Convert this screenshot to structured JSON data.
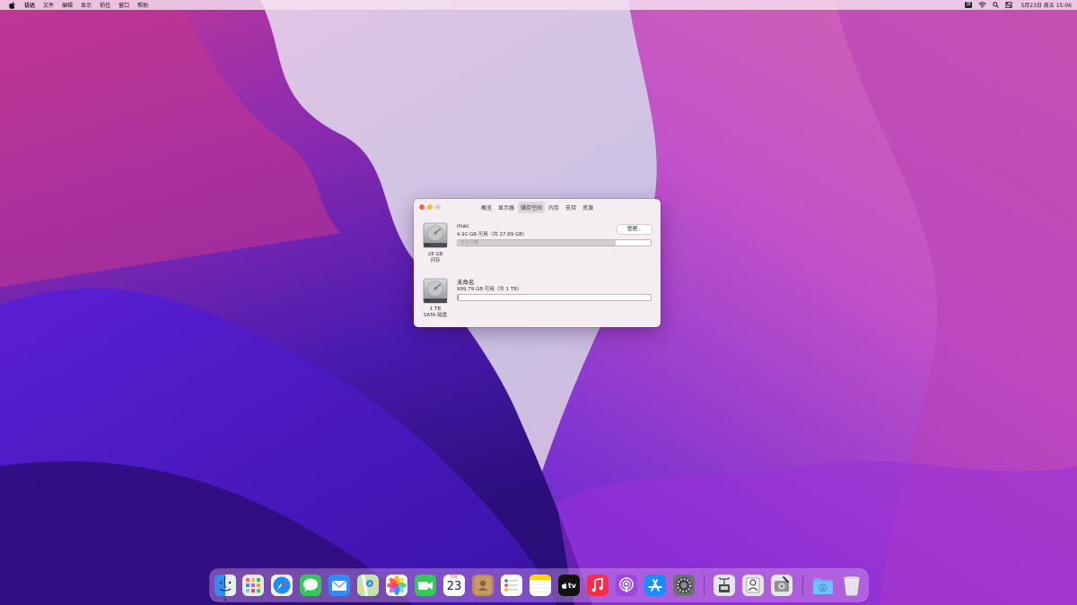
{
  "menubar": {
    "app_menus": [
      "访达",
      "文件",
      "编辑",
      "显示",
      "前往",
      "窗口",
      "帮助"
    ],
    "status_icons": [
      "input-method-icon",
      "wifi-icon",
      "spotlight-icon",
      "control-center-icon"
    ],
    "input_badge": "拼",
    "clock": "5月23日 周五 15:06"
  },
  "window": {
    "tabs": [
      "概览",
      "显示器",
      "储存空间",
      "内存",
      "支持",
      "资源"
    ],
    "active_tab": "储存空间",
    "drives": [
      {
        "name": "mac",
        "available": "4.92 GB 可用（共 27.69 GB）",
        "size_label": "28 GB",
        "type_label": "闪存",
        "used_fraction": 0.82,
        "bar_text": "正在计算...",
        "manage_label": "管理..."
      },
      {
        "name": "未命名",
        "available": "999.79 GB 可用（共 1 TB）",
        "size_label": "1 TB",
        "type_label": "SATA 磁盘",
        "used_fraction": 0.002
      }
    ]
  },
  "dock": {
    "apps": [
      "finder-icon",
      "launchpad-icon",
      "safari-icon",
      "messages-icon",
      "mail-icon",
      "maps-icon",
      "photos-icon",
      "facetime-icon",
      "calendar-icon",
      "contacts-icon",
      "reminders-icon",
      "notes-icon",
      "apple-tv-icon",
      "music-icon",
      "podcasts-icon",
      "app-store-icon",
      "system-preferences-icon",
      "network-utility-icon",
      "system-information-icon",
      "disk-utility-icon",
      "downloads-folder-icon",
      "trash-icon"
    ],
    "calendar_month": "5月",
    "calendar_day": "23",
    "tv_label": "tv"
  },
  "colors": {
    "menubar_bg": "#f6e1f0",
    "close": "#fe5f57",
    "minimize": "#febc2e",
    "accent_blue": "#1a8cff"
  }
}
